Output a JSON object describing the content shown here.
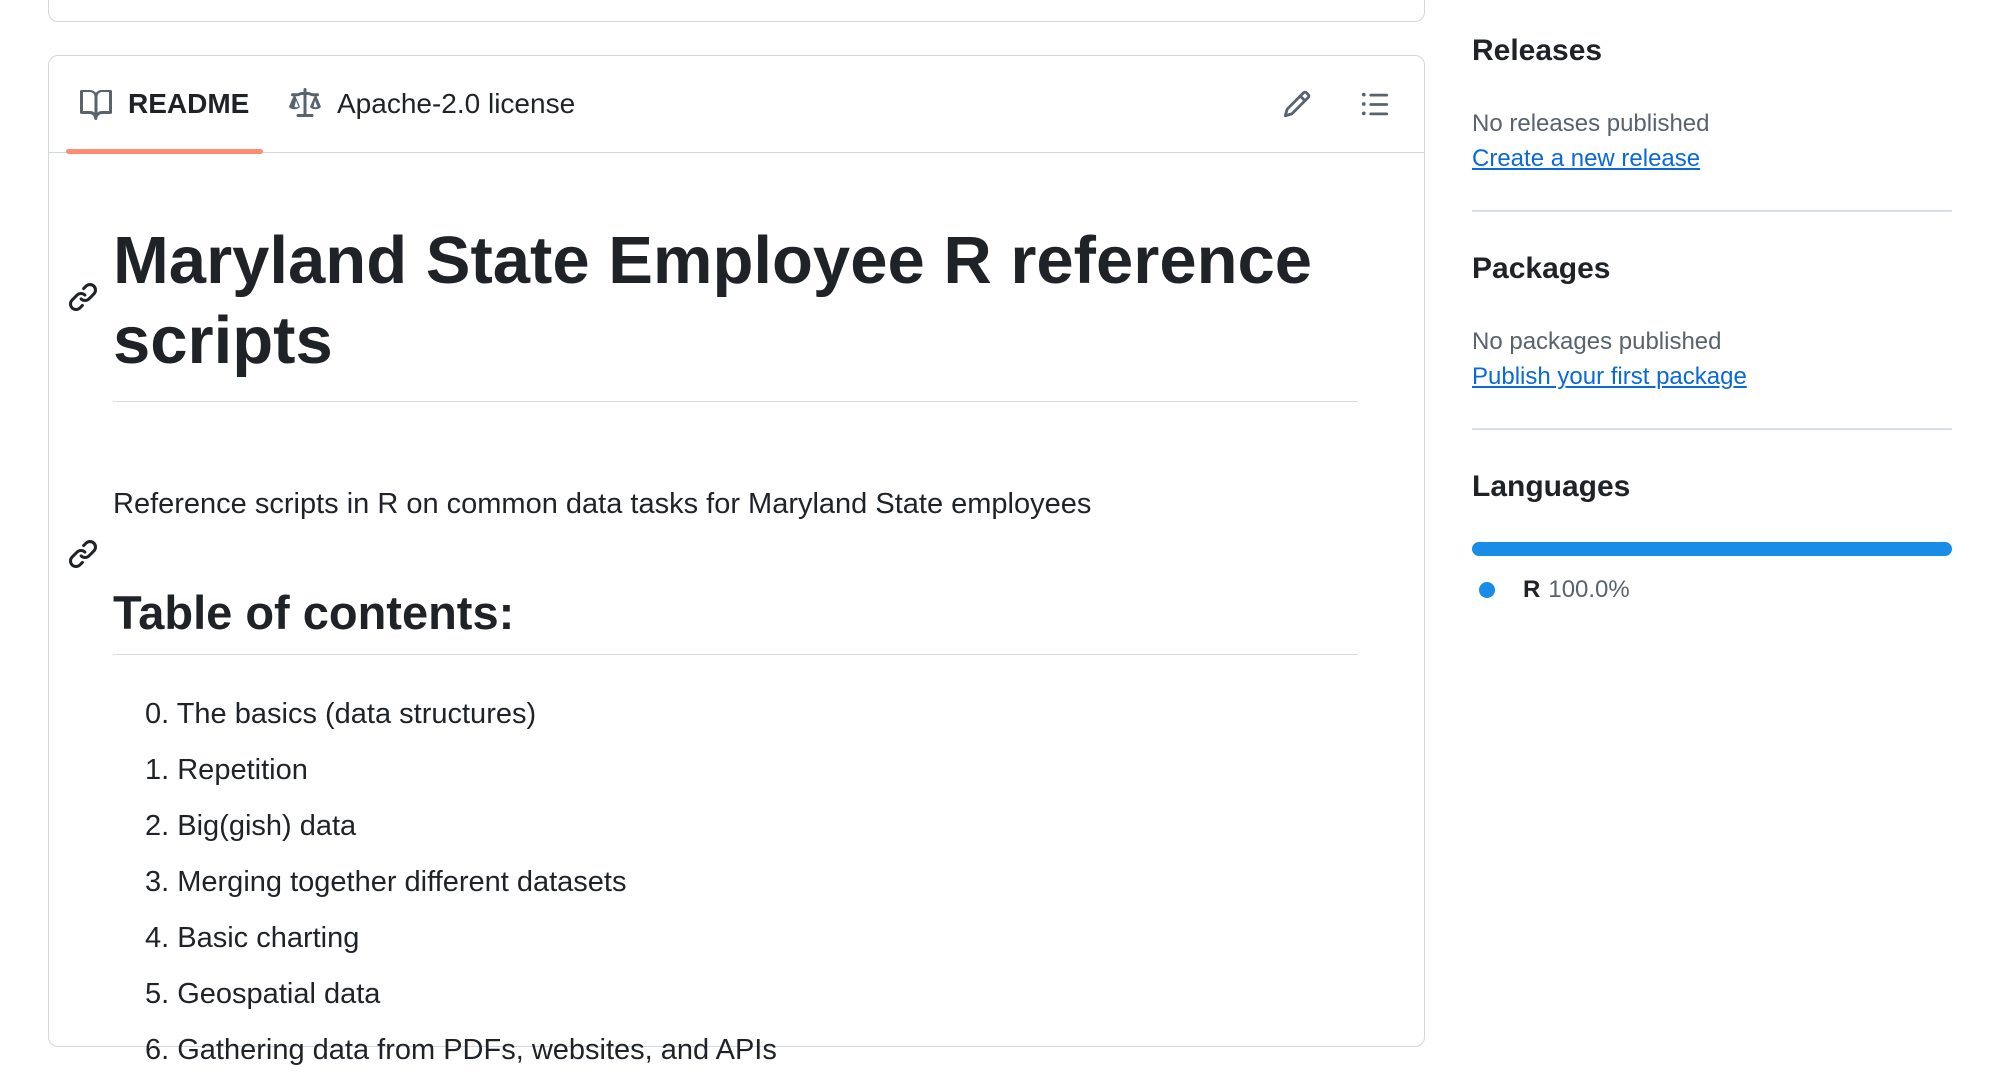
{
  "readme": {
    "tabs": [
      {
        "label": "README",
        "icon": "book-icon"
      },
      {
        "label": "Apache-2.0 license",
        "icon": "law-icon"
      }
    ],
    "actions": {
      "edit_icon": "pencil-icon",
      "outline_icon": "list-unordered-icon"
    },
    "title": "Maryland State Employee R reference scripts",
    "description": "Reference scripts in R on common data tasks for Maryland State employees",
    "toc_heading": "Table of contents:",
    "toc_items": [
      "0. The basics (data structures)",
      "1. Repetition",
      "2. Big(gish) data",
      "3. Merging together different datasets",
      "4. Basic charting",
      "5. Geospatial data",
      "6. Gathering data from PDFs, websites, and APIs"
    ]
  },
  "sidebar": {
    "releases": {
      "title": "Releases",
      "status": "No releases published",
      "link": "Create a new release"
    },
    "packages": {
      "title": "Packages",
      "status": "No packages published",
      "link": "Publish your first package"
    },
    "languages": {
      "title": "Languages",
      "items": [
        {
          "name": "R",
          "percent": "100.0%",
          "share": 1.0,
          "color": "#198ce7"
        }
      ]
    }
  },
  "colors": {
    "accent_tab": "#fd8c73",
    "link": "#0969da",
    "border": "#d0d7de"
  }
}
